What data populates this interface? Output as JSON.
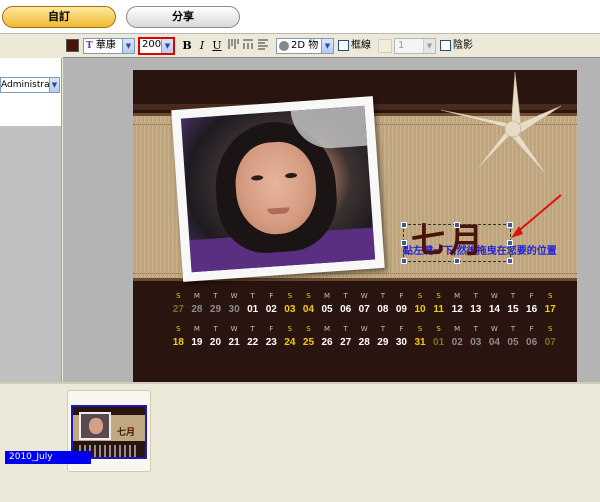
{
  "tabs": [
    {
      "label": "自訂",
      "active": true
    },
    {
      "label": "分享",
      "active": false
    }
  ],
  "toolbar": {
    "font_name": "華康",
    "font_size": "200",
    "bold": "B",
    "italic": "I",
    "underline": "U",
    "effect": "2D 物",
    "border_label": "框線",
    "border_width": "1",
    "shadow_label": "陰影",
    "text_color": "#4a1208"
  },
  "left_panel": {
    "user": "Administrator"
  },
  "calendar": {
    "hint": "點左鍵一下,然後拖曳在您要的位置",
    "month_title": "七月",
    "weekday_row1": [
      "S",
      "M",
      "T",
      "W",
      "T",
      "F",
      "S",
      "S",
      "M",
      "T",
      "W",
      "T",
      "F",
      "S",
      "S",
      "M",
      "T",
      "W",
      "T",
      "F",
      "S"
    ],
    "dates_row1": [
      "27",
      "28",
      "29",
      "30",
      "01",
      "02",
      "03",
      "04",
      "05",
      "06",
      "07",
      "08",
      "09",
      "10",
      "11",
      "12",
      "13",
      "14",
      "15",
      "16",
      "17"
    ],
    "weekday_row2": [
      "S",
      "M",
      "T",
      "W",
      "T",
      "F",
      "S",
      "S",
      "M",
      "T",
      "W",
      "T",
      "F",
      "S",
      "S",
      "M",
      "T",
      "W",
      "T",
      "F",
      "S"
    ],
    "dates_row2": [
      "18",
      "19",
      "20",
      "21",
      "22",
      "23",
      "24",
      "25",
      "26",
      "27",
      "28",
      "29",
      "30",
      "31",
      "01",
      "02",
      "03",
      "04",
      "05",
      "06",
      "07"
    ]
  },
  "thumbnails": [
    {
      "label": "2010_July",
      "title": "七月",
      "selected": true
    }
  ]
}
